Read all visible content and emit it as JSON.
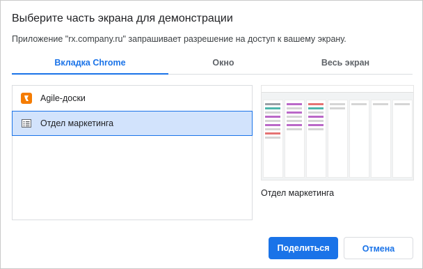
{
  "dialog": {
    "title": "Выберите часть экрана для демонстрации",
    "subtitle": "Приложение \"rx.company.ru\" запрашивает разрешение на доступ к вашему экрану."
  },
  "tabs": [
    {
      "label": "Вкладка Chrome",
      "active": true
    },
    {
      "label": "Окно",
      "active": false
    },
    {
      "label": "Весь экран",
      "active": false
    }
  ],
  "tab_list": {
    "items": [
      {
        "label": "Agile-доски",
        "icon": "orange-app-icon",
        "selected": false
      },
      {
        "label": "Отдел маркетинга",
        "icon": "page-icon",
        "selected": true
      }
    ]
  },
  "preview": {
    "caption": "Отдел маркетинга"
  },
  "buttons": {
    "share": "Поделиться",
    "cancel": "Отмена"
  },
  "colors": {
    "accent": "#1a73e8",
    "selected_bg": "#d2e3fc",
    "agile_icon": "#f57c00"
  }
}
